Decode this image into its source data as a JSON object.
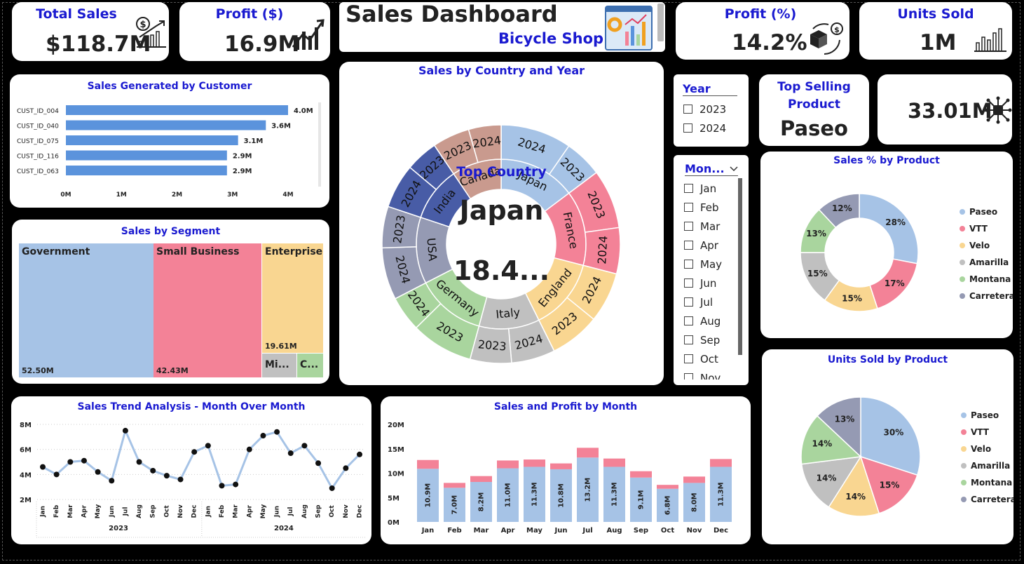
{
  "dashboard": {
    "title": "Sales Dashboard",
    "subtitle": "Bicycle Shop"
  },
  "kpis": {
    "total_sales": {
      "label": "Total Sales",
      "value": "$118.7M"
    },
    "profit": {
      "label": "Profit ($)",
      "value": "16.9M"
    },
    "profit_pct": {
      "label": "Profit (%)",
      "value": "14.2%"
    },
    "units_sold": {
      "label": "Units Sold",
      "value": "1M"
    },
    "top_product": {
      "label": "Top Selling Product",
      "value": "Paseo"
    },
    "top_product_sales": {
      "value": "33.01M"
    }
  },
  "top_country": {
    "label": "Top Country",
    "name": "Japan",
    "value": "18.4..."
  },
  "slicers": {
    "year": {
      "title": "Year",
      "options": [
        "2023",
        "2024"
      ]
    },
    "month": {
      "title": "Mon...",
      "options": [
        "Jan",
        "Feb",
        "Mar",
        "Apr",
        "May",
        "Jun",
        "Jul",
        "Aug",
        "Sep",
        "Oct",
        "Nov"
      ]
    }
  },
  "colors": {
    "blue": "#a6c3e6",
    "pink": "#f38297",
    "yellow": "#f9d691",
    "grey": "#c0c0c0",
    "green": "#a9d59e",
    "slate": "#959ab3",
    "navy": "#485ca6",
    "rose": "#c99a8e",
    "title": "#1a1ad0",
    "bar": "#5b93dc"
  },
  "chart_data": [
    {
      "id": "customers",
      "type": "bar",
      "title": "Sales Generated by Customer",
      "categories": [
        "CUST_ID_004",
        "CUST_ID_040",
        "CUST_ID_075",
        "CUST_ID_116",
        "CUST_ID_063"
      ],
      "values": [
        4.0,
        3.6,
        3.1,
        2.9,
        2.9
      ],
      "value_labels": [
        "4.0M",
        "3.6M",
        "3.1M",
        "2.9M",
        "2.9M"
      ],
      "xticks": [
        "0M",
        "1M",
        "2M",
        "3M",
        "4M"
      ],
      "xlim": [
        0,
        4
      ]
    },
    {
      "id": "segment",
      "type": "treemap",
      "title": "Sales by Segment",
      "items": [
        {
          "label": "Government",
          "value": 52.5,
          "value_label": "52.50M"
        },
        {
          "label": "Small Business",
          "value": 42.43,
          "value_label": "42.43M"
        },
        {
          "label": "Enterprise",
          "value": 19.61,
          "value_label": "19.61M"
        },
        {
          "label": "Mi...",
          "value": 2.4
        },
        {
          "label": "C...",
          "value": 1.8
        }
      ]
    },
    {
      "id": "country",
      "type": "sunburst",
      "title": "Sales by Country and Year",
      "countries": [
        {
          "name": "Japan",
          "value": 18.4,
          "years": [
            {
              "year": "2024",
              "value": 12.0
            },
            {
              "year": "2023",
              "value": 6.4
            }
          ]
        },
        {
          "name": "France",
          "value": 17.8,
          "years": [
            {
              "year": "2023",
              "value": 10.0
            },
            {
              "year": "2024",
              "value": 7.8
            }
          ]
        },
        {
          "name": "England",
          "value": 17.0,
          "years": [
            {
              "year": "2024",
              "value": 8.5
            },
            {
              "year": "2023",
              "value": 8.5
            }
          ]
        },
        {
          "name": "Italy",
          "value": 14.4,
          "years": [
            {
              "year": "2024",
              "value": 7.4
            },
            {
              "year": "2023",
              "value": 7.0
            }
          ]
        },
        {
          "name": "Germany",
          "value": 16.5,
          "years": [
            {
              "year": "2023",
              "value": 10.5
            },
            {
              "year": "2024",
              "value": 6.0
            }
          ]
        },
        {
          "name": "USA",
          "value": 15.8,
          "years": [
            {
              "year": "2024",
              "value": 8.8
            },
            {
              "year": "2023",
              "value": 7.0
            }
          ]
        },
        {
          "name": "India",
          "value": 13.0,
          "years": [
            {
              "year": "2024",
              "value": 7.5
            },
            {
              "year": "2023",
              "value": 5.5
            }
          ]
        },
        {
          "name": "Canada",
          "value": 11.8,
          "years": [
            {
              "year": "2023",
              "value": 6.3
            },
            {
              "year": "2024",
              "value": 5.5
            }
          ]
        }
      ]
    },
    {
      "id": "trend",
      "type": "line",
      "title": "Sales Trend Analysis - Month Over Month",
      "x": [
        "Jan",
        "Feb",
        "Mar",
        "Apr",
        "May",
        "Jun",
        "Jul",
        "Aug",
        "Sep",
        "Oct",
        "Nov",
        "Dec",
        "Jan",
        "Feb",
        "Mar",
        "Apr",
        "May",
        "Jun",
        "Jul",
        "Aug",
        "Sep",
        "Oct",
        "Nov",
        "Dec"
      ],
      "groups": [
        {
          "label": "2023",
          "start": 0,
          "end": 11
        },
        {
          "label": "2024",
          "start": 12,
          "end": 23
        }
      ],
      "values": [
        4.6,
        4.0,
        5.0,
        5.1,
        4.2,
        3.5,
        7.5,
        5.0,
        4.3,
        3.9,
        3.6,
        5.8,
        6.3,
        3.1,
        3.2,
        6.0,
        7.1,
        7.4,
        5.7,
        6.3,
        4.9,
        2.9,
        4.5,
        5.6
      ],
      "yticks": [
        "2M",
        "4M",
        "6M",
        "8M"
      ],
      "ylim": [
        2,
        8
      ]
    },
    {
      "id": "monthly",
      "type": "bar",
      "title": "Sales and Profit by Month",
      "categories": [
        "Jan",
        "Feb",
        "Mar",
        "Apr",
        "May",
        "Jun",
        "Jul",
        "Aug",
        "Sep",
        "Oct",
        "Nov",
        "Dec"
      ],
      "series": [
        {
          "values": [
            10.9,
            7.0,
            8.2,
            11.0,
            11.3,
            10.8,
            13.2,
            11.3,
            9.1,
            6.8,
            8.0,
            11.3
          ],
          "labels": [
            "10.9M",
            "7.0M",
            "8.2M",
            "11.0M",
            "11.3M",
            "10.8M",
            "13.2M",
            "11.3M",
            "9.1M",
            "6.8M",
            "8.0M",
            "11.3M"
          ]
        },
        {
          "values": [
            1.8,
            1.0,
            1.2,
            1.6,
            1.5,
            1.2,
            2.0,
            1.7,
            1.3,
            0.8,
            1.3,
            1.6
          ]
        }
      ],
      "yticks": [
        "0M",
        "5M",
        "10M",
        "15M",
        "20M"
      ],
      "ylim": [
        0,
        20
      ]
    },
    {
      "id": "sales_pct",
      "type": "pie",
      "title": "Sales % by Product",
      "labels": [
        "Paseo",
        "VTT",
        "Velo",
        "Amarilla",
        "Montana",
        "Carretera"
      ],
      "values": [
        28,
        17,
        15,
        15,
        13,
        12
      ],
      "value_labels": [
        "28%",
        "17%",
        "15%",
        "15%",
        "13%",
        "12%"
      ]
    },
    {
      "id": "units_pct",
      "type": "pie",
      "title": "Units Sold by Product",
      "labels": [
        "Paseo",
        "VTT",
        "Velo",
        "Amarilla",
        "Montana",
        "Carretera"
      ],
      "values": [
        30,
        15,
        14,
        14,
        14,
        13
      ],
      "value_labels": [
        "30%",
        "15%",
        "14%",
        "14%",
        "14%",
        "13%"
      ]
    }
  ]
}
